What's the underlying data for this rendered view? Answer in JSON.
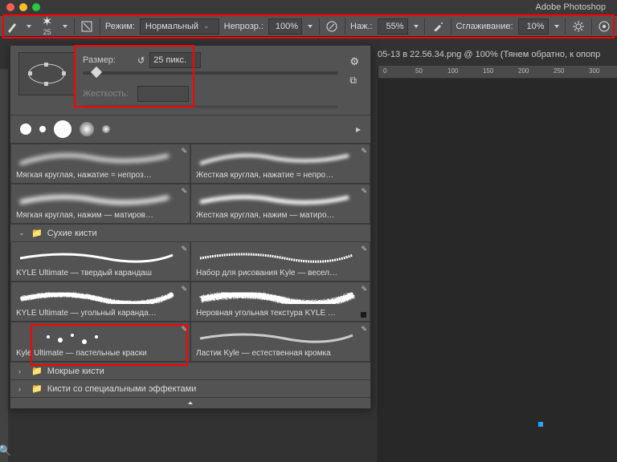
{
  "title": "Adobe Photoshop",
  "options": {
    "brush_size": "25",
    "mode_label": "Режим:",
    "mode_value": "Нормальный",
    "opacity_label": "Непрозр.:",
    "opacity_value": "100%",
    "flow_label": "Наж.:",
    "flow_value": "55%",
    "smoothing_label": "Сглаживание:",
    "smoothing_value": "10%"
  },
  "brush_panel": {
    "size_label": "Размер:",
    "size_value": "25 пикс.",
    "hardness_label": "Жесткость:",
    "hardness_value": ""
  },
  "folders": {
    "dry": "Сухие кисти",
    "wet": "Мокрые кисти",
    "fx": "Кисти со специальными эффектами"
  },
  "presets_top": [
    "Мягкая круглая, нажатие = непроз…",
    "Жесткая круглая, нажатие = непро…",
    "Мягкая круглая, нажим — матиров…",
    "Жесткая круглая, нажим — матиро…"
  ],
  "presets_dry": [
    "KYLE Ultimate — твердый карандаш",
    "Набор для рисования Kyle — весел…",
    "KYLE Ultimate — угольный каранда…",
    "Неровная угольная текстура KYLE …",
    "Kyle Ultimate — пастельные краски",
    "Ластик Kyle — естественная кромка"
  ],
  "document_tab": "05-13 в 22.56.34.png @ 100% (Тянем обратно,  к опопр",
  "ruler_ticks": [
    "0",
    "50",
    "100",
    "150",
    "200",
    "250",
    "300"
  ]
}
